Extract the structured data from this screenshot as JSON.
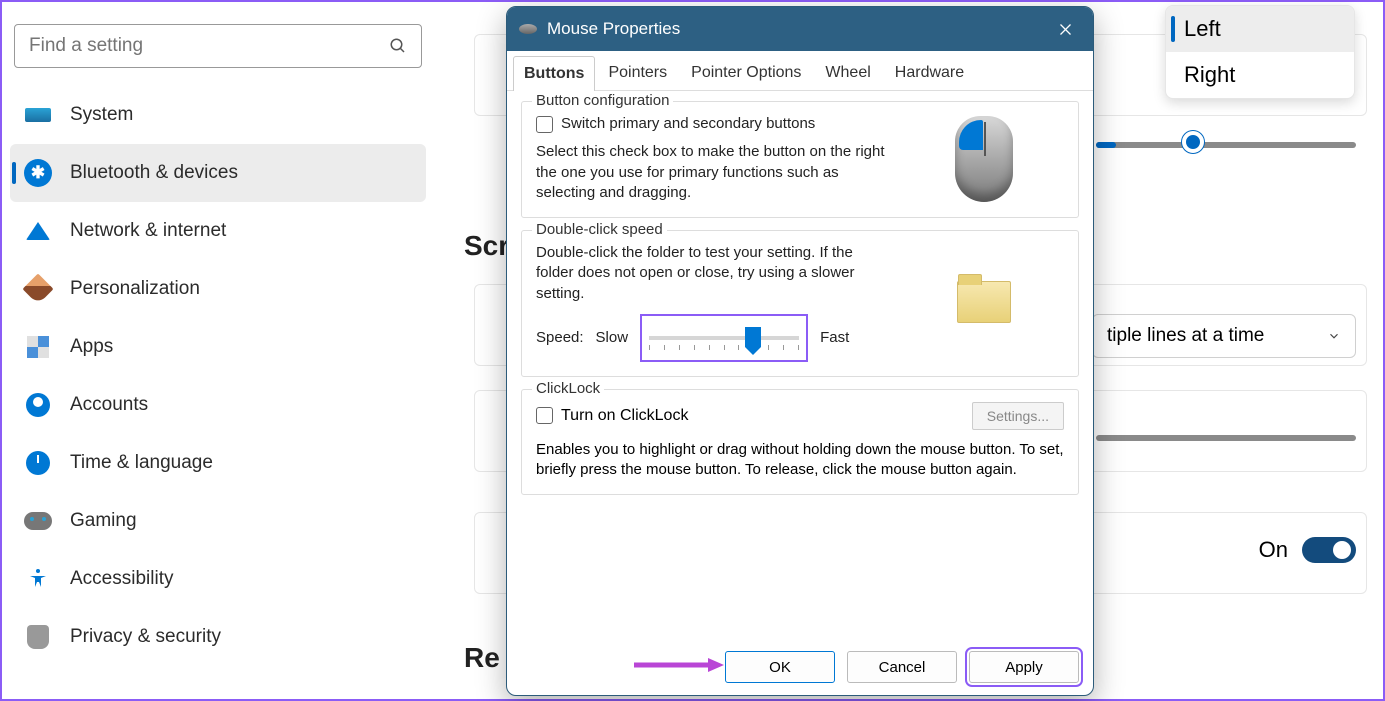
{
  "search": {
    "placeholder": "Find a setting"
  },
  "sidebar": {
    "items": [
      {
        "label": "System"
      },
      {
        "label": "Bluetooth & devices"
      },
      {
        "label": "Network & internet"
      },
      {
        "label": "Personalization"
      },
      {
        "label": "Apps"
      },
      {
        "label": "Accounts"
      },
      {
        "label": "Time & language"
      },
      {
        "label": "Gaming"
      },
      {
        "label": "Accessibility"
      },
      {
        "label": "Privacy & security"
      }
    ],
    "active_index": 1
  },
  "main": {
    "scrolling_heading_fragment": "Scr",
    "related_heading_fragment": "Re",
    "primary_button": {
      "options": [
        "Left",
        "Right"
      ],
      "selected": "Left"
    },
    "scroll_mode": {
      "value": "Multiple lines at a time",
      "visible_fragment": "tiple lines at a time"
    },
    "toggle": {
      "label": "On",
      "state": true
    }
  },
  "dialog": {
    "title": "Mouse Properties",
    "tabs": [
      "Buttons",
      "Pointers",
      "Pointer Options",
      "Wheel",
      "Hardware"
    ],
    "active_tab": 0,
    "group_button_config": {
      "legend": "Button configuration",
      "checkbox_label": "Switch primary and secondary buttons",
      "description": "Select this check box to make the button on the right the one you use for primary functions such as selecting and dragging."
    },
    "group_dclick": {
      "legend": "Double-click speed",
      "description": "Double-click the folder to test your setting. If the folder does not open or close, try using a slower setting.",
      "label_speed": "Speed:",
      "label_slow": "Slow",
      "label_fast": "Fast"
    },
    "group_clicklock": {
      "legend": "ClickLock",
      "checkbox_label": "Turn on ClickLock",
      "settings_button": "Settings...",
      "description": "Enables you to highlight or drag without holding down the mouse button. To set, briefly press the mouse button. To release, click the mouse button again."
    },
    "buttons": {
      "ok": "OK",
      "cancel": "Cancel",
      "apply": "Apply"
    }
  }
}
